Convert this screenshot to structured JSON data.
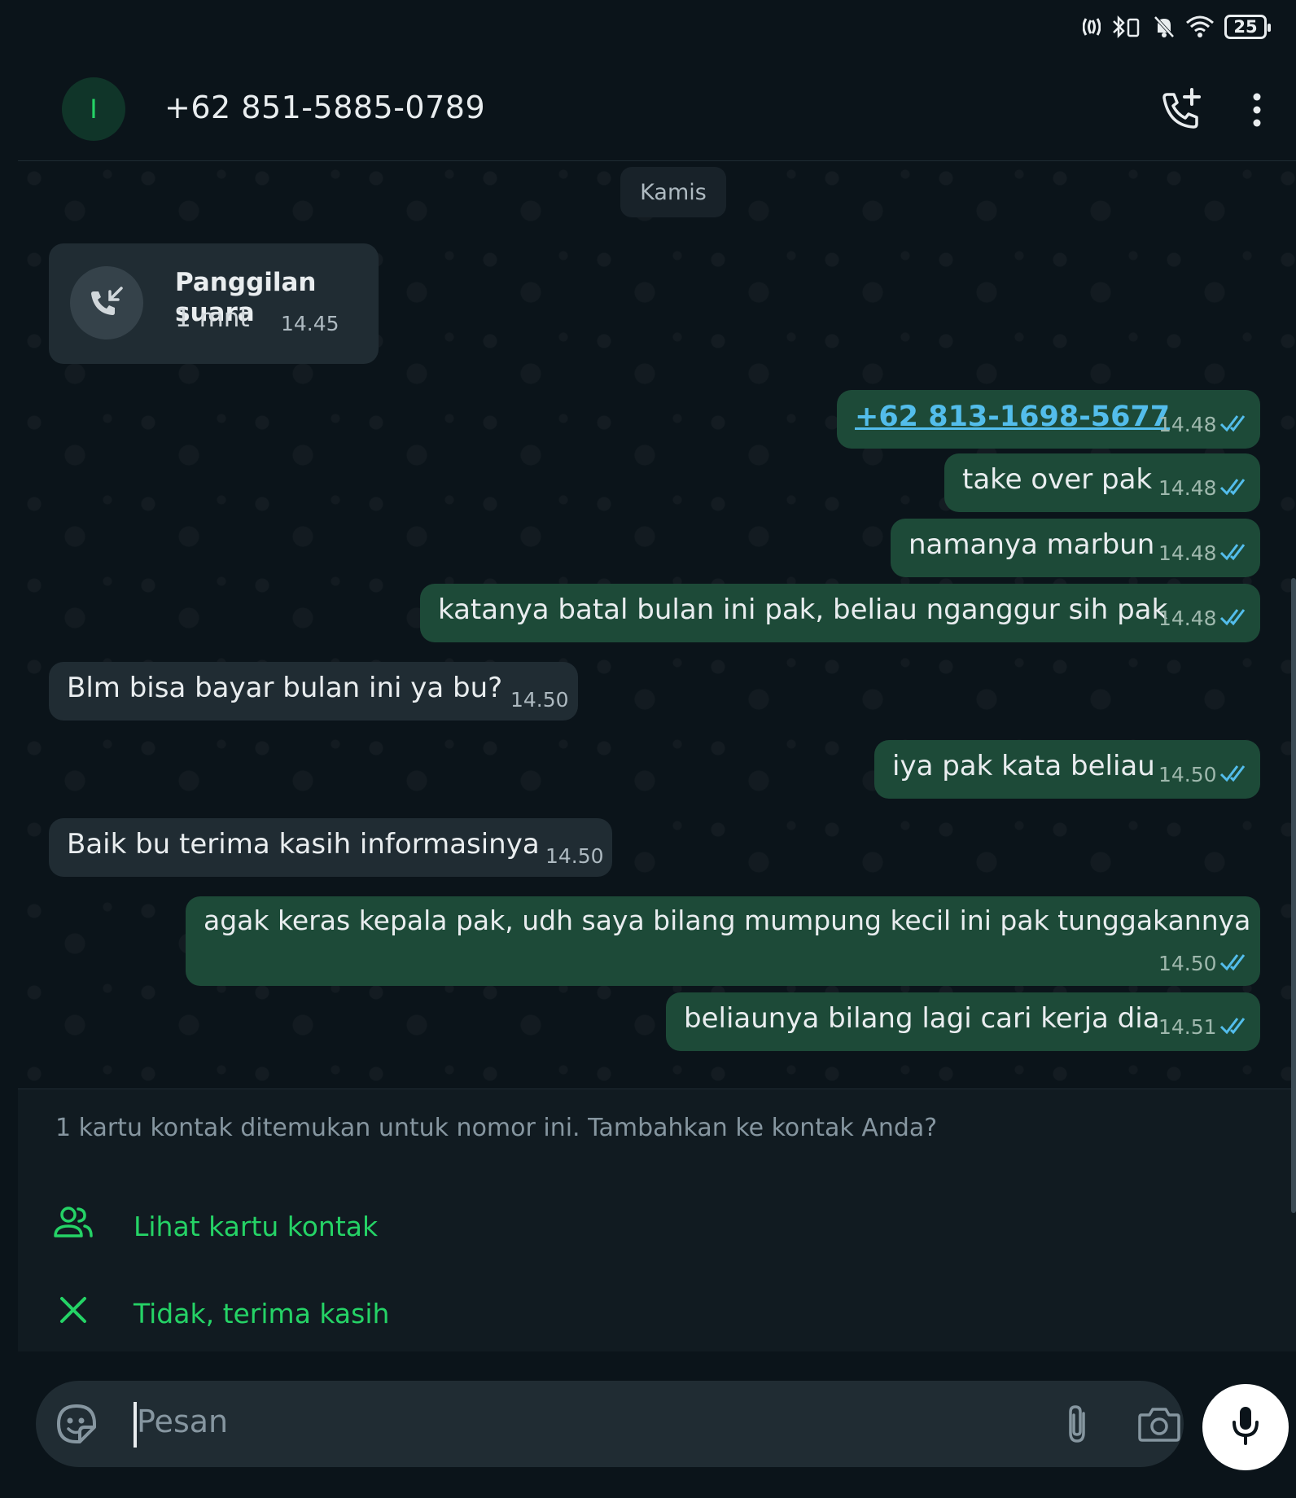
{
  "status_bar": {
    "battery_level": "25",
    "icons": [
      "nfc-icon",
      "bluetooth-vibrate-icon",
      "notifications-off-icon",
      "wifi-icon",
      "battery-icon"
    ]
  },
  "header": {
    "avatar_letter": "I",
    "title": "+62 851-5885-0789",
    "actions": [
      "add-call-icon",
      "more-options-icon"
    ]
  },
  "chat": {
    "day_chip": "Kamis",
    "call": {
      "title": "Panggilan suara",
      "duration": "1 mnt",
      "time": "14.45"
    },
    "messages": [
      {
        "dir": "out",
        "text": "+62 813-1698-5677",
        "time": "14.48",
        "is_link": true
      },
      {
        "dir": "out",
        "text": "take over pak",
        "time": "14.48"
      },
      {
        "dir": "out",
        "text": "namanya marbun",
        "time": "14.48"
      },
      {
        "dir": "out",
        "text": "katanya batal bulan ini pak, beliau nganggur sih pak",
        "time": "14.48"
      },
      {
        "dir": "in",
        "text": "Blm bisa bayar bulan ini ya bu?",
        "time": "14.50"
      },
      {
        "dir": "out",
        "text": "iya pak kata beliau",
        "time": "14.50"
      },
      {
        "dir": "in",
        "text": "Baik bu terima kasih informasinya",
        "time": "14.50"
      },
      {
        "dir": "out",
        "text": "agak keras kepala pak, udh saya bilang mumpung kecil ini pak tunggakannya",
        "time": "14.50"
      },
      {
        "dir": "out",
        "text": "beliaunya bilang lagi cari kerja dia",
        "time": "14.51"
      }
    ]
  },
  "contact_banner": {
    "message": "1 kartu kontak ditemukan untuk nomor ini. Tambahkan ke kontak Anda?",
    "view_label": "Lihat kartu kontak",
    "dismiss_label": "Tidak, terima kasih"
  },
  "input": {
    "placeholder": "Pesan"
  },
  "colors": {
    "background": "#0b141a",
    "incoming_bubble": "#202c33",
    "outgoing_bubble": "#1d4a38",
    "accent": "#25d366",
    "link": "#53bdeb"
  }
}
